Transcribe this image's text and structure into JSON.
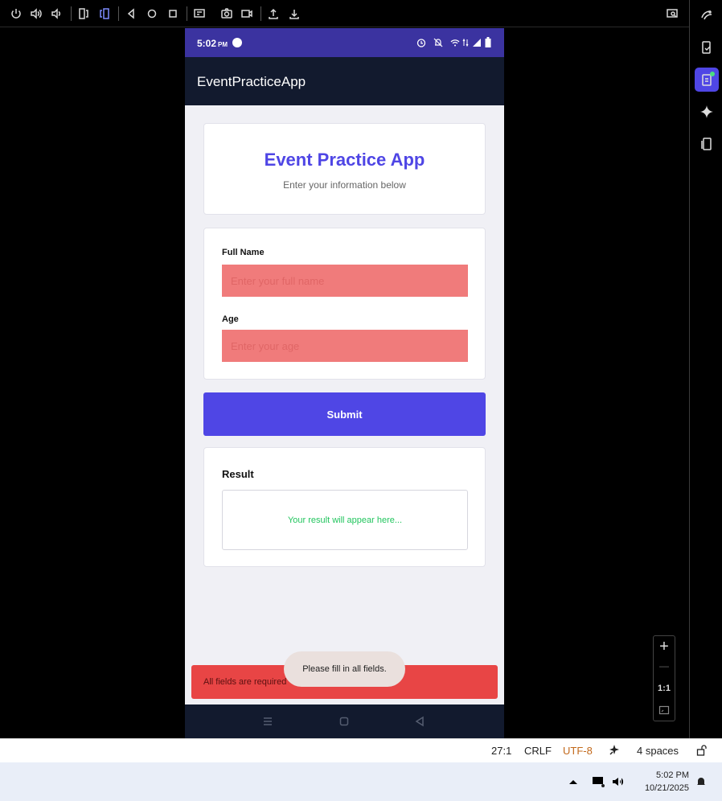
{
  "toolbar": {
    "icons": [
      "power-icon",
      "volume-up-icon",
      "volume-down-icon",
      "rotate-left-icon",
      "rotate-right-icon",
      "back-icon",
      "home-icon",
      "overview-icon",
      "fold-icon",
      "screenshot-icon",
      "record-icon",
      "upload-icon",
      "download-icon",
      "search-window-icon"
    ]
  },
  "right_panel": {
    "icons": [
      "running-devices-icon",
      "device-manager-icon",
      "device-explorer-icon",
      "gemini-icon",
      "device-mirroring-icon"
    ]
  },
  "phone": {
    "status_time": "5:02",
    "status_ampm": "PM",
    "app_title": "EventPracticeApp",
    "header": {
      "title": "Event Practice App",
      "subtitle": "Enter your information below"
    },
    "form": {
      "name_label": "Full Name",
      "name_placeholder": "Enter your full name",
      "age_label": "Age",
      "age_placeholder": "Enter your age"
    },
    "submit_label": "Submit",
    "result": {
      "title": "Result",
      "placeholder_text": "Your result will appear here..."
    },
    "error_text": "All fields are required",
    "toast_text": "Please fill in all fields."
  },
  "zoom": {
    "zoom_in": "+",
    "zoom_out": "—",
    "ratio": "1:1"
  },
  "ide_status": {
    "position": "27:1",
    "line_ending": "CRLF",
    "encoding": "UTF-8",
    "indent": "4 spaces",
    "encoding_color": "#c2691b"
  },
  "taskbar": {
    "time": "5:02 PM",
    "date": "10/21/2025"
  }
}
